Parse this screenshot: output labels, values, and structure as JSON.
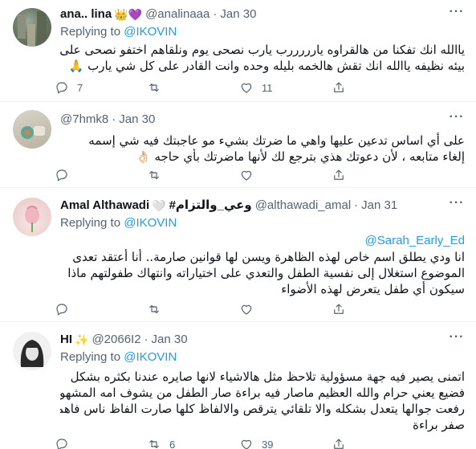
{
  "tweets": [
    {
      "name": "ana.. lina",
      "name_emoji": "👑💜",
      "handle": "@analinaaa",
      "sep": "·",
      "date": "Jan 30",
      "replying_prefix": "Replying to",
      "replying_to": "@IKOVIN",
      "mention": "",
      "lines": [
        "ياالله انك تفكنا من هالقراوه يارررررب يارب نصحى يوم ونلقاهم اختفو نصحى على",
        "بيئه نظيفه ياالله انك تقش هالخمه بليله وحده وانت القادر على كل شي يارب 🙏"
      ],
      "reply_count": "7",
      "retweet_count": "",
      "like_count": "11"
    },
    {
      "name": "",
      "name_emoji": "",
      "handle": "@7hmk8",
      "sep": "·",
      "date": "Jan 30",
      "replying_prefix": "",
      "replying_to": "",
      "mention": "",
      "lines": [
        "على أي اساس تدعين عليها واهي ما ضرتك بشيء مو عاجبتك فيه شي إسمه",
        "إلغاء متابعه ، لأن دعوتك هذي بترجع لك لأنها ماضرتك بأي حاجه 👌🏻"
      ],
      "reply_count": "",
      "retweet_count": "",
      "like_count": ""
    },
    {
      "name": "Amal Althawadi",
      "name_emoji": "🤍",
      "name_suffix": "#وعي_والتزام",
      "handle": "@althawadi_amal",
      "sep": "·",
      "date": "Jan 31",
      "replying_prefix": "Replying to",
      "replying_to": "@IKOVIN",
      "mention": "@Sarah_Early_Ed",
      "lines": [
        "انا ودي يطلق اسم خاص  لهذه الظاهرة ويسن لها قوانين صارمة.. أنا أعتقد تعدى",
        "الموضوع استغلال إلى نفسية الطفل والتعدي على  اختياراته  وانتهاك طفولتهم ماذا",
        "سيكون أي طفل يتعرض لهذه الأضواء"
      ],
      "reply_count": "",
      "retweet_count": "",
      "like_count": ""
    },
    {
      "name": "HI",
      "name_emoji": "✨",
      "handle": "@2066I2",
      "sep": "·",
      "date": "Jan 30",
      "replying_prefix": "Replying to",
      "replying_to": "@IKOVIN",
      "mention": "",
      "lines": [
        "اتمنى يصير فيه جهة مسؤولية تلاحظ مثل هالاشياء لانها صايره عندنا بكثره بشكل",
        "فضيع يعني حرام والله العظيم ماصار فيه براءة صار الطفل من يشوف امه المشهوره",
        "رفعت جوالها يتعدل بشكله والا تلقائي يترقص والالفاظ كلها صارت الفاظ ناس فاهمه",
        "صفر براءة"
      ],
      "reply_count": "",
      "retweet_count": "6",
      "like_count": "39"
    }
  ],
  "more_glyph": "···",
  "icons": [
    "reply-icon",
    "retweet-icon",
    "like-icon",
    "share-icon"
  ]
}
